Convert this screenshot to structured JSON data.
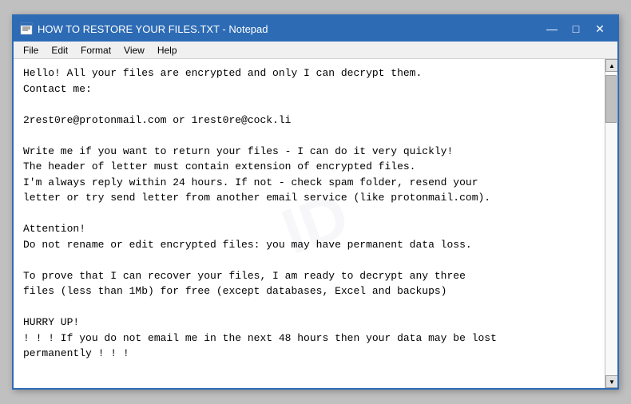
{
  "window": {
    "title": "HOW TO RESTORE YOUR FILES.TXT - Notepad",
    "icon": "📄"
  },
  "titlebar": {
    "minimize_label": "—",
    "maximize_label": "□",
    "close_label": "✕"
  },
  "menubar": {
    "items": [
      "File",
      "Edit",
      "Format",
      "View",
      "Help"
    ]
  },
  "content": {
    "text": "Hello! All your files are encrypted and only I can decrypt them.\nContact me:\n\n2rest0re@protonmail.com or 1rest0re@cock.li\n\nWrite me if you want to return your files - I can do it very quickly!\nThe header of letter must contain extension of encrypted files.\nI'm always reply within 24 hours. If not - check spam folder, resend your\nletter or try send letter from another email service (like protonmail.com).\n\nAttention!\nDo not rename or edit encrypted files: you may have permanent data loss.\n\nTo prove that I can recover your files, I am ready to decrypt any three\nfiles (less than 1Mb) for free (except databases, Excel and backups)\n\nHURRY UP!\n! ! ! If you do not email me in the next 48 hours then your data may be lost\npermanently ! ! !"
  },
  "watermark": "ID"
}
